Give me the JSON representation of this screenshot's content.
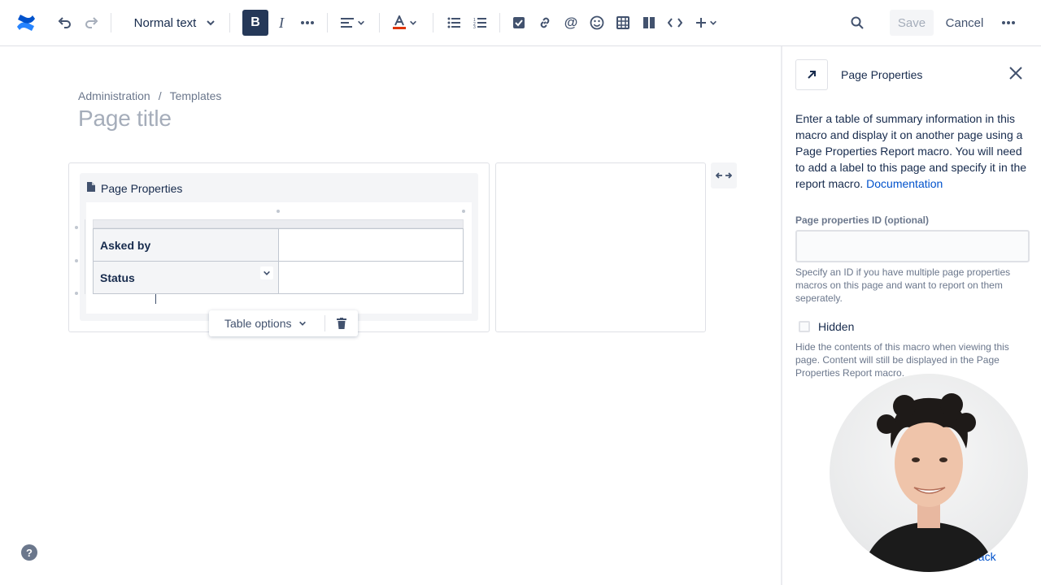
{
  "toolbar": {
    "text_style": "Normal text",
    "save_label": "Save",
    "cancel_label": "Cancel"
  },
  "breadcrumb": [
    "Administration",
    "Templates"
  ],
  "page_title_placeholder": "Page title",
  "macro": {
    "title": "Page Properties",
    "rows": [
      {
        "label": "Asked by",
        "value": ""
      },
      {
        "label": "Status",
        "value": ""
      }
    ],
    "table_options_label": "Table options"
  },
  "sidebar": {
    "title": "Page Properties",
    "description": "Enter a table of summary information in this macro and display it on another page using a Page Properties Report macro. You will need to add a label to this page and specify it in the report macro.",
    "doc_link": "Documentation",
    "id_label": "Page properties ID (optional)",
    "id_value": "",
    "id_hint": "Specify an ID if you have multiple page properties macros on this page and want to report on them seperately.",
    "hidden_label": "Hidden",
    "hidden_checked": false,
    "hidden_hint": "Hide the contents of this macro when viewing this page. Content will still be displayed in the Page Properties Report macro.",
    "feedback_partial": "back"
  },
  "colors": {
    "brand": "#2684ff",
    "bold_active": "#253858",
    "link": "#0052cc"
  },
  "icons": [
    "confluence-logo-icon",
    "undo-icon",
    "redo-icon",
    "chevron-down-icon",
    "bold-icon",
    "italic-icon",
    "more-formatting-icon",
    "align-icon",
    "text-color-icon",
    "bullet-list-icon",
    "numbered-list-icon",
    "task-icon",
    "link-icon",
    "mention-icon",
    "emoji-icon",
    "table-icon",
    "layout-icon",
    "code-icon",
    "insert-plus-icon",
    "search-icon",
    "more-icon",
    "document-icon",
    "expand-width-icon",
    "trash-icon",
    "help-icon",
    "close-icon",
    "macro-icon"
  ]
}
